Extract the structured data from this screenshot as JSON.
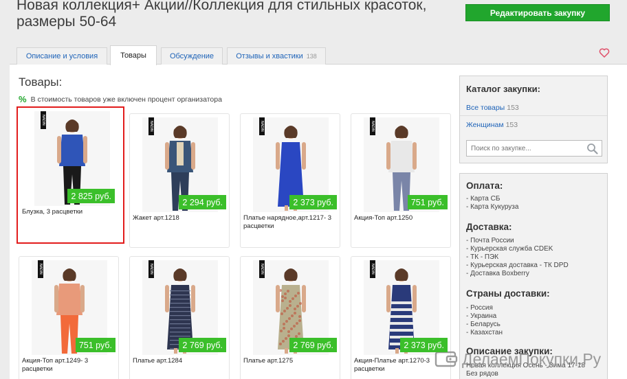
{
  "header": {
    "title": "Новая коллекция+ Акции//Коллекция для стильных красоток, размеры 50-64",
    "edit_button": "Редактировать закупку"
  },
  "tabs": [
    {
      "label": "Описание и условия",
      "count": ""
    },
    {
      "label": "Товары",
      "count": ""
    },
    {
      "label": "Обсуждение",
      "count": ""
    },
    {
      "label": "Отзывы и хвастики",
      "count": "138"
    }
  ],
  "products_heading": "Товары:",
  "percent_icon": "%",
  "percent_note": "В стоимость товаров уже включен процент организатора",
  "products": [
    {
      "name": "Блузка, 3 расцветки",
      "price": "2 825 руб.",
      "top_color": "#2f55b8",
      "bottom_color": "#1a1a1a"
    },
    {
      "name": "Жакет арт.1218",
      "price": "2 294 руб.",
      "top_color": "#3a5578",
      "bottom_color": "#2e3e5a"
    },
    {
      "name": "Платье нарядное,арт.1217- 3 расцветки",
      "price": "2 373 руб.",
      "top_color": "#2a47c2",
      "bottom_color": "#2a47c2"
    },
    {
      "name": "Акция-Топ арт.1250",
      "price": "751 руб.",
      "top_color": "#e8e8e8",
      "bottom_color": "#7a85a8"
    },
    {
      "name": "Акция-Топ арт.1249- 3 расцветки",
      "price": "751 руб.",
      "top_color": "#e89a7a",
      "bottom_color": "#f26a3a"
    },
    {
      "name": "Платье арт.1284",
      "price": "2 769 руб.",
      "top_color": "#2e3550",
      "bottom_color": "#2e3550"
    },
    {
      "name": "Платье арт.1275",
      "price": "2 769 руб.",
      "top_color": "#b9b08e",
      "bottom_color": "#b9b08e"
    },
    {
      "name": "Акция-Платье арт.1270-3 расцветки",
      "price": "2 373 руб.",
      "top_color": "#2a3a7a",
      "bottom_color": "#3b6fd1"
    }
  ],
  "brand_tag": "NADIN",
  "sidebar": {
    "catalog_title": "Каталог закупки:",
    "links": [
      {
        "label": "Все товары",
        "count": "153"
      },
      {
        "label": "Женщинам",
        "count": "153"
      }
    ],
    "search_placeholder": "Поиск по закупке...",
    "payment_title": "Оплата:",
    "payment_items": [
      "- Карта СБ",
      "- Карта Кукуруза"
    ],
    "delivery_title": "Доставка:",
    "delivery_items": [
      "- Почта России",
      "- Курьерская служба CDEK",
      "- ТК - ПЭК",
      "- Курьерская доставка - ТК DPD",
      "- Доставка Boxberry"
    ],
    "countries_title": "Страны доставки:",
    "countries_items": [
      "- Россия",
      "- Украина",
      "- Беларусь",
      "- Казахстан"
    ],
    "description_title": "Описание закупки:",
    "description_text": [
      "Новая коллекция Осень - Зима 17-18",
      "Без рядов"
    ]
  },
  "watermark": "ДелаемПокупки.Ру",
  "colors": {
    "accent_green": "#21a62d",
    "price_green": "#3bbf2a",
    "link_blue": "#1e63b8",
    "selection_red": "#e21b1b"
  }
}
